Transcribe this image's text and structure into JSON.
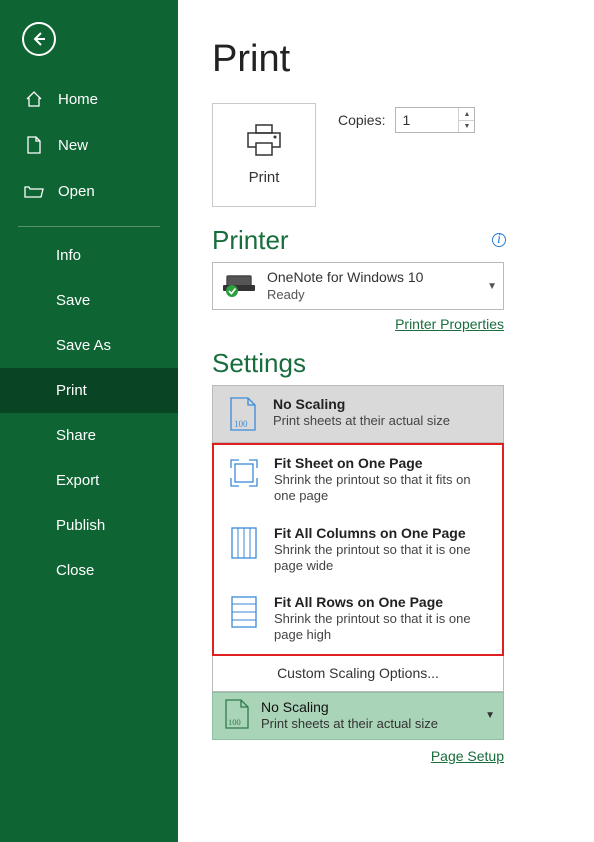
{
  "page_title": "Print",
  "sidebar": {
    "items": [
      {
        "label": "Home"
      },
      {
        "label": "New"
      },
      {
        "label": "Open"
      }
    ],
    "sub_items": [
      {
        "label": "Info"
      },
      {
        "label": "Save"
      },
      {
        "label": "Save As"
      },
      {
        "label": "Print",
        "active": true
      },
      {
        "label": "Share"
      },
      {
        "label": "Export"
      },
      {
        "label": "Publish"
      },
      {
        "label": "Close"
      }
    ]
  },
  "print_tile_label": "Print",
  "copies": {
    "label": "Copies:",
    "value": "1"
  },
  "printer_heading": "Printer",
  "printer": {
    "name": "OneNote for Windows 10",
    "status": "Ready"
  },
  "printer_properties_link": "Printer Properties",
  "settings_heading": "Settings",
  "scaling": {
    "selected": {
      "title": "No Scaling",
      "desc": "Print sheets at their actual size"
    },
    "options": [
      {
        "title": "Fit Sheet on One Page",
        "desc": "Shrink the printout so that it fits on one page"
      },
      {
        "title": "Fit All Columns on One Page",
        "desc": "Shrink the printout so that it is one page wide"
      },
      {
        "title": "Fit All Rows on One Page",
        "desc": "Shrink the printout so that it is one page high"
      }
    ],
    "custom": "Custom Scaling Options...",
    "current": {
      "title": "No Scaling",
      "desc": "Print sheets at their actual size"
    }
  },
  "page_setup_link": "Page Setup"
}
